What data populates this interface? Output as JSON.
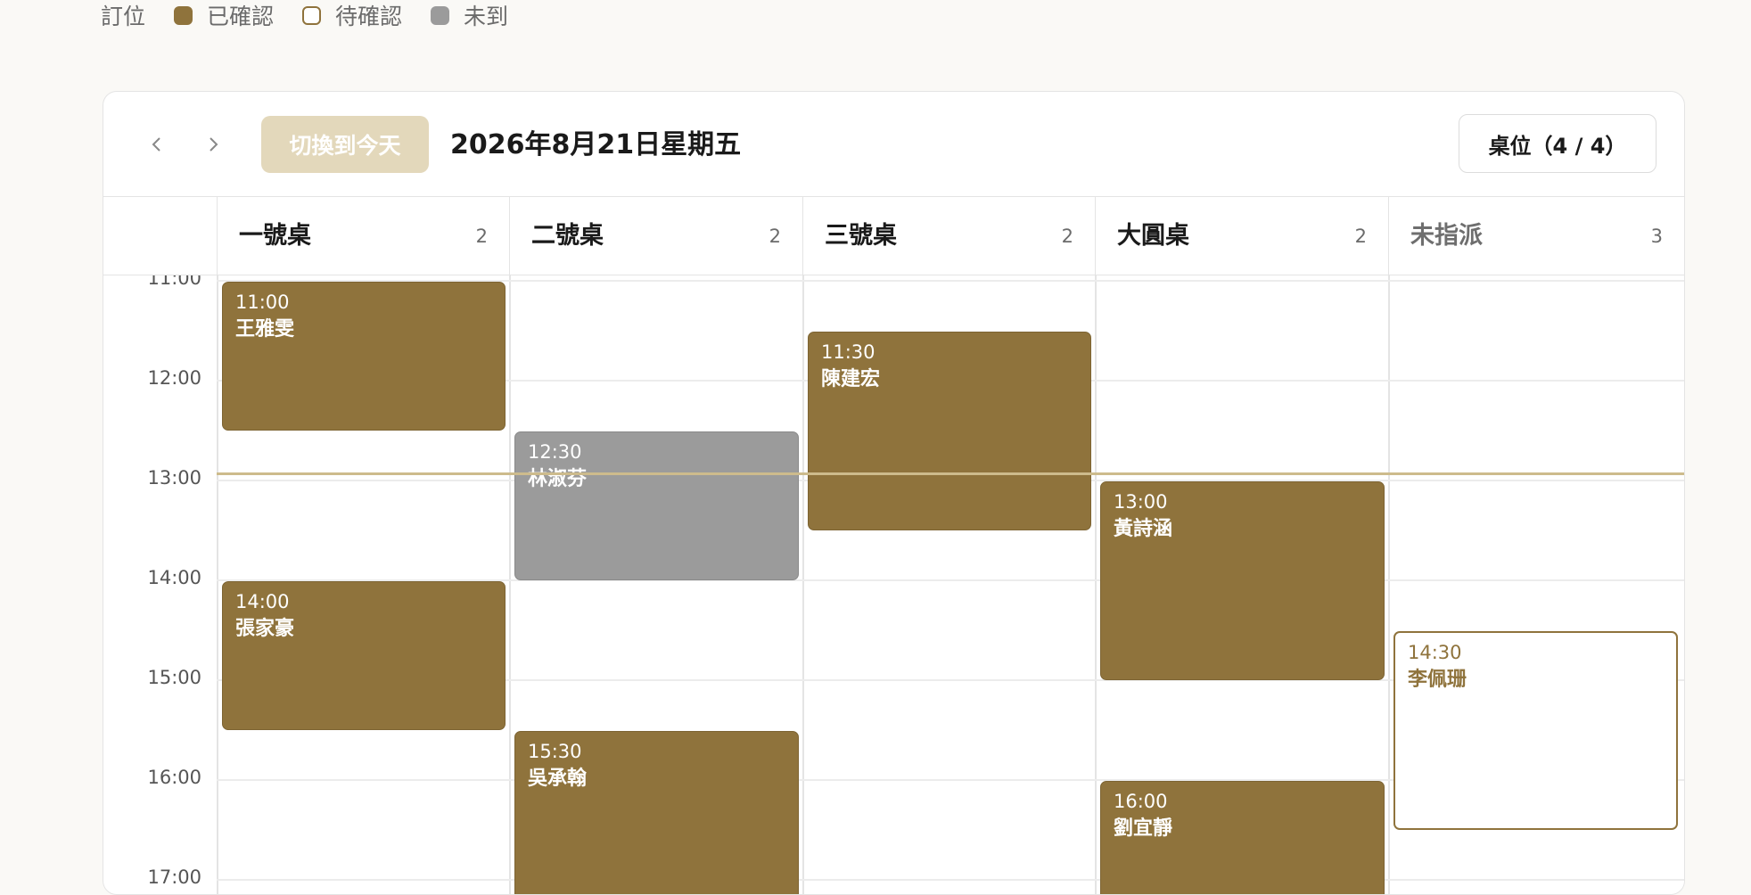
{
  "legend": {
    "title": "訂位",
    "items": [
      {
        "label": "已確認",
        "status": "confirmed"
      },
      {
        "label": "待確認",
        "status": "pending"
      },
      {
        "label": "未到",
        "status": "noshow"
      }
    ]
  },
  "toolbar": {
    "today_label": "切換到今天",
    "date": "2026年8月21日星期五",
    "tables_label": "桌位（4 / 4）"
  },
  "columns": [
    {
      "name": "一號桌",
      "count": "2"
    },
    {
      "name": "二號桌",
      "count": "2"
    },
    {
      "name": "三號桌",
      "count": "2"
    },
    {
      "name": "大圓桌",
      "count": "2"
    },
    {
      "name": "未指派",
      "count": "3"
    }
  ],
  "time_labels": [
    "11:00",
    "12:00",
    "13:00",
    "14:00",
    "15:00",
    "16:00",
    "17:00"
  ],
  "reservations": [
    {
      "time": "11:00",
      "name": "王雅雯",
      "status": "confirmed"
    },
    {
      "time": "14:00",
      "name": "張家豪",
      "status": "confirmed"
    },
    {
      "time": "12:30",
      "name": "林淑芬",
      "status": "noshow"
    },
    {
      "time": "15:30",
      "name": "吳承翰",
      "status": "confirmed"
    },
    {
      "time": "11:30",
      "name": "陳建宏",
      "status": "confirmed"
    },
    {
      "time": "13:00",
      "name": "黃詩涵",
      "status": "confirmed"
    },
    {
      "time": "16:00",
      "name": "劉宜靜",
      "status": "confirmed"
    },
    {
      "time": "14:30",
      "name": "李佩珊",
      "status": "pending"
    }
  ],
  "colors": {
    "confirmed": "#8f733c",
    "pending_border": "#8f733c",
    "noshow": "#9b9b9b",
    "today_button": "#e3d8bb",
    "now_line": "#cdbb8c"
  },
  "icons": {
    "prev": "chevron-left-icon",
    "next": "chevron-right-icon"
  }
}
